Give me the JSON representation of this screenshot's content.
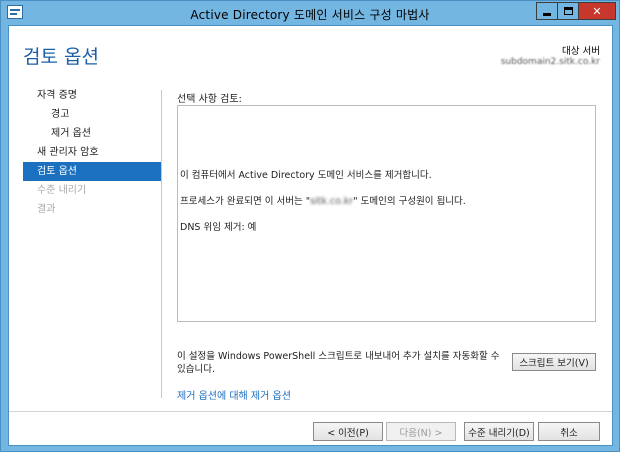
{
  "window": {
    "title": "Active Directory 도메인 서비스 구성 마법사",
    "controls": {
      "minimize": "minimize",
      "maximize": "maximize",
      "close": "close"
    }
  },
  "header": {
    "page_title": "검토 옵션",
    "target_label": "대상 서버",
    "target_server": "subdomain2.sitk.co.kr"
  },
  "nav": {
    "items": [
      {
        "label": "자격 증명",
        "level": 0,
        "state": "normal"
      },
      {
        "label": "경고",
        "level": 1,
        "state": "normal"
      },
      {
        "label": "제거 옵션",
        "level": 1,
        "state": "normal"
      },
      {
        "label": "새 관리자 암호",
        "level": 0,
        "state": "normal"
      },
      {
        "label": "검토 옵션",
        "level": 0,
        "state": "active"
      },
      {
        "label": "수준 내리기",
        "level": 0,
        "state": "disabled"
      },
      {
        "label": "결과",
        "level": 0,
        "state": "disabled"
      }
    ]
  },
  "review": {
    "section_label": "선택 사항 검토:",
    "line1": "이 컴퓨터에서 Active Directory 도메인 서비스를 제거합니다.",
    "line2_prefix": "프로세스가 완료되면 이 서버는 \"",
    "line2_domain": "sitk.co.kr",
    "line2_suffix": "\" 도메인의 구성원이 됩니다.",
    "line3": "DNS 위임 제거: 예"
  },
  "export": {
    "note": "이 설정을 Windows PowerShell 스크립트로 내보내어 추가 설치를 자동화할 수 있습니다.",
    "view_script_label": "스크립트 보기(V)"
  },
  "more_link": "제거 옵션에 대해 제거 옵션",
  "footer": {
    "prev_label": "< 이전(P)",
    "next_label": "다음(N) >",
    "demote_label": "수준 내리기(D)",
    "cancel_label": "취소"
  },
  "colors": {
    "title_bar": "#74b6e2",
    "accent": "#1a5fa8",
    "nav_active": "#1b70c0",
    "link": "#1e6fc0",
    "close_button": "#c7372b"
  }
}
